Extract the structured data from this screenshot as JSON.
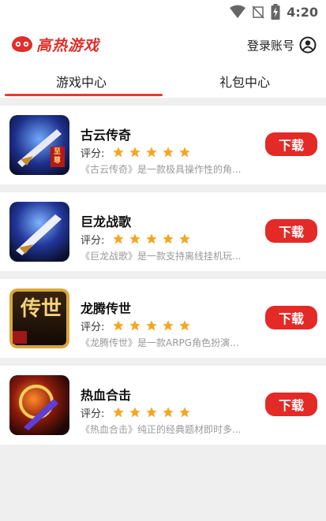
{
  "status_bar": {
    "time": "4:20",
    "icons": [
      "wifi-icon",
      "signal-off-icon",
      "battery-charging-icon"
    ]
  },
  "header": {
    "logo_text": "高热游戏",
    "login_label": "登录账号"
  },
  "tabs": [
    {
      "label": "游戏中心",
      "active": true
    },
    {
      "label": "礼包中心",
      "active": false
    }
  ],
  "games": [
    {
      "title": "古云传奇",
      "rating_label": "评分:",
      "stars": 5,
      "desc": "《古云传奇》是一款极具操作性的角...",
      "button": "下载",
      "thumb_badge": "至尊"
    },
    {
      "title": "巨龙战歌",
      "rating_label": "评分:",
      "stars": 5,
      "desc": "《巨龙战歌》是一款支持离线挂机玩...",
      "button": "下载",
      "thumb_badge": ""
    },
    {
      "title": "龙腾传世",
      "rating_label": "评分:",
      "stars": 5,
      "desc": "《龙腾传世》是一款ARPG角色扮演...",
      "button": "下载",
      "thumb_badge": "传世"
    },
    {
      "title": "热血合击",
      "rating_label": "评分:",
      "stars": 5,
      "desc": "《热血合击》纯正的经典题材即时多...",
      "button": "下载",
      "thumb_badge": ""
    }
  ],
  "colors": {
    "accent": "#e32a26",
    "star": "#f5a623",
    "background": "#efefef"
  }
}
